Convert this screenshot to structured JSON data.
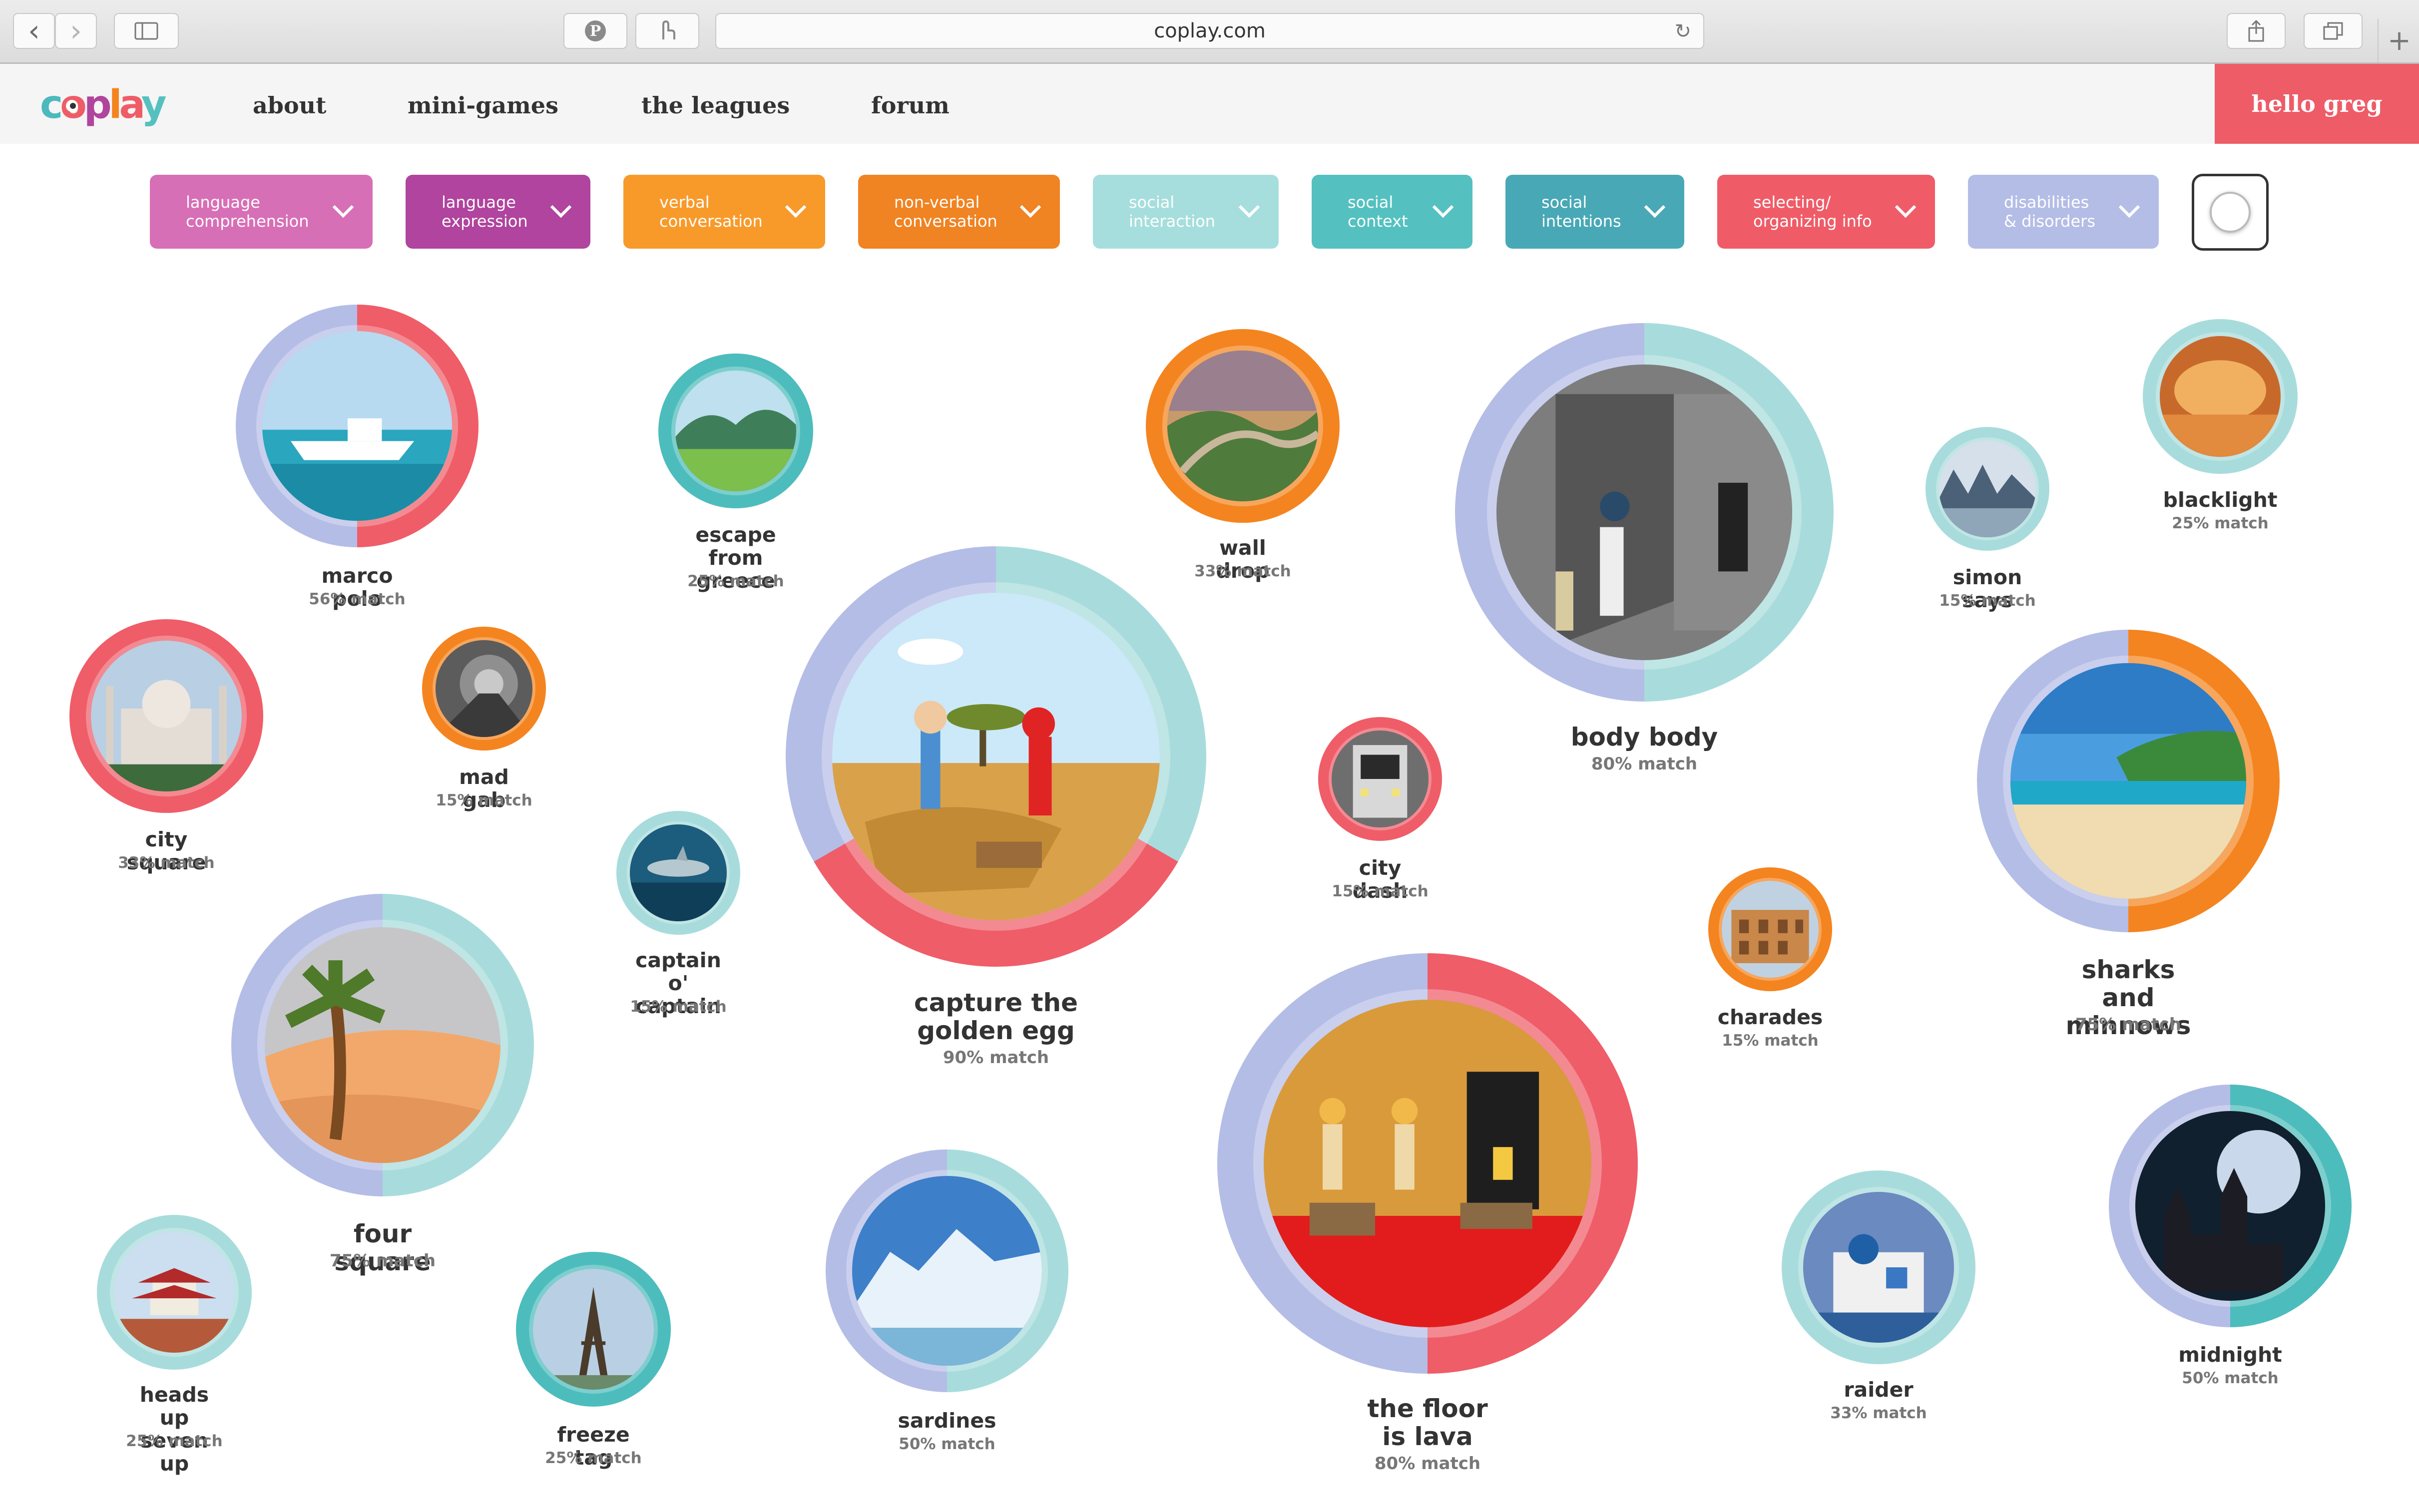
{
  "browser": {
    "url": "coplay.com",
    "back_glyph": "‹",
    "forward_glyph": "›",
    "newtab_glyph": "+",
    "reload_glyph": "↻"
  },
  "site": {
    "logo_text": "coplay",
    "nav": [
      "about",
      "mini-games",
      "the leagues",
      "forum"
    ],
    "user_greeting": "hello greg"
  },
  "filters": [
    {
      "label": "language\ncomprehension",
      "color": "#d76fb6"
    },
    {
      "label": "language\nexpression",
      "color": "#b0449e"
    },
    {
      "label": "verbal\nconversation",
      "color": "#f89a2a"
    },
    {
      "label": "non-verbal\nconversation",
      "color": "#f08322"
    },
    {
      "label": "social\ninteraction",
      "color": "#a6dedd"
    },
    {
      "label": "social\ncontext",
      "color": "#54c1c0"
    },
    {
      "label": "social\nintentions",
      "color": "#48a8b6"
    },
    {
      "label": "selecting/\norganizing info",
      "color": "#ef5c68"
    },
    {
      "label": "disabilities\n& disorders",
      "color": "#b4bde6"
    }
  ],
  "colors": {
    "lavender": "#b4bde6",
    "coral": "#ef5d68",
    "orange": "#f4841f",
    "teal": "#4dbcbc",
    "aqua": "#a8dcdc"
  },
  "games": [
    {
      "title": "marco polo",
      "match": "56% match",
      "match_pct": 56,
      "scene": "boat",
      "ring": [
        "lavender",
        "coral"
      ]
    },
    {
      "title": "escape from\ngreece",
      "match": "25% match",
      "match_pct": 25,
      "scene": "hills",
      "ring": [
        "teal"
      ]
    },
    {
      "title": "wall drop",
      "match": "33% match",
      "match_pct": 33,
      "scene": "greatwall",
      "ring": [
        "orange"
      ]
    },
    {
      "title": "body body",
      "match": "80% match",
      "match_pct": 80,
      "scene": "gallery",
      "ring": [
        "lavender",
        "aqua"
      ]
    },
    {
      "title": "blacklight",
      "match": "25% match",
      "match_pct": 25,
      "scene": "cave",
      "ring": [
        "aqua"
      ]
    },
    {
      "title": "simon says",
      "match": "15% match",
      "match_pct": 15,
      "scene": "mountains",
      "ring": [
        "aqua"
      ]
    },
    {
      "title": "city square",
      "match": "33% match",
      "match_pct": 33,
      "scene": "tajmahal",
      "ring": [
        "coral"
      ]
    },
    {
      "title": "mad gab",
      "match": "15% match",
      "match_pct": 15,
      "scene": "tunnel",
      "ring": [
        "orange"
      ]
    },
    {
      "title": "capture the\ngolden egg",
      "match": "90% match",
      "match_pct": 90,
      "scene": "desert",
      "ring": [
        "lavender",
        "aqua",
        "coral"
      ]
    },
    {
      "title": "city dash",
      "match": "15% match",
      "match_pct": 15,
      "scene": "subway",
      "ring": [
        "coral"
      ]
    },
    {
      "title": "sharks and\nminnows",
      "match": "75% match",
      "match_pct": 75,
      "scene": "beach",
      "ring": [
        "lavender",
        "orange"
      ]
    },
    {
      "title": "captain\no' captain",
      "match": "15% match",
      "match_pct": 15,
      "scene": "shark",
      "ring": [
        "aqua"
      ]
    },
    {
      "title": "four square",
      "match": "75% match",
      "match_pct": 75,
      "scene": "palm",
      "ring": [
        "lavender",
        "aqua"
      ]
    },
    {
      "title": "charades",
      "match": "15% match",
      "match_pct": 15,
      "scene": "colosseum",
      "ring": [
        "orange"
      ]
    },
    {
      "title": "the floor\nis lava",
      "match": "80% match",
      "match_pct": 80,
      "scene": "lava",
      "ring": [
        "lavender",
        "coral"
      ]
    },
    {
      "title": "midnight",
      "match": "50% match",
      "match_pct": 50,
      "scene": "castle",
      "ring": [
        "lavender",
        "teal"
      ]
    },
    {
      "title": "heads up\nseven up",
      "match": "25% match",
      "match_pct": 25,
      "scene": "pagoda",
      "ring": [
        "aqua"
      ]
    },
    {
      "title": "freeze tag",
      "match": "25% match",
      "match_pct": 25,
      "scene": "eiffel",
      "ring": [
        "teal"
      ]
    },
    {
      "title": "sardines",
      "match": "50% match",
      "match_pct": 50,
      "scene": "glacier",
      "ring": [
        "lavender",
        "aqua"
      ]
    },
    {
      "title": "raider",
      "match": "33% match",
      "match_pct": 33,
      "scene": "santorini",
      "ring": [
        "aqua"
      ]
    }
  ]
}
